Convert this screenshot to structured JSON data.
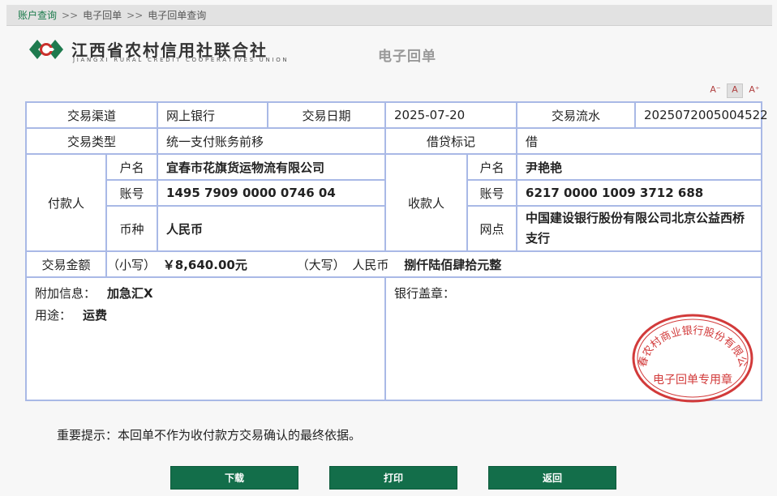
{
  "breadcrumb": {
    "items": [
      "账户查询",
      "电子回单",
      "电子回单查询"
    ],
    "separator": ">>"
  },
  "logo": {
    "cn": "江西省农村信用社联合社",
    "en": "JIANGXI RURAL CREDIT COOPERATIVES UNION"
  },
  "page_title": "电子回单",
  "font_size_controls": [
    "A⁻",
    "A",
    "A⁺"
  ],
  "receipt": {
    "row1": {
      "channel_label": "交易渠道",
      "channel_value": "网上银行",
      "date_label": "交易日期",
      "date_value": "2025-07-20",
      "serial_label": "交易流水",
      "serial_value": "2025072005004522"
    },
    "row2": {
      "type_label": "交易类型",
      "type_value": "统一支付账务前移",
      "dc_label": "借贷标记",
      "dc_value": "借"
    },
    "payer": {
      "label": "付款人",
      "name_label": "户名",
      "name": "宜春市花旗货运物流有限公司",
      "account_label": "账号",
      "account": "1495 7909 0000 0746 04",
      "currency_label": "币种",
      "currency": "人民币"
    },
    "payee": {
      "label": "收款人",
      "name_label": "户名",
      "name": "尹艳艳",
      "account_label": "账号",
      "account": "6217 0000 1009 3712 688",
      "branch_label": "网点",
      "branch": "中国建设银行股份有限公司北京公益西桥支行"
    },
    "amount": {
      "label": "交易金额",
      "small_label": "（小写）",
      "small_value": "￥8,640.00元",
      "big_label": "（大写）",
      "big_currency": "人民币",
      "big_value": "捌仟陆佰肆拾元整"
    },
    "extra": {
      "info_label": "附加信息：",
      "info_value": "加急汇X",
      "use_label": "用途：",
      "use_value": "运费",
      "seal_label": "银行盖章："
    },
    "seal": {
      "top_text": "宜春农村商业银行股份有限公司",
      "bottom_text": "电子回单专用章",
      "color": "#d23a3a"
    }
  },
  "notice": "重要提示：本回单不作为收付款方交易确认的最终依据。",
  "buttons": {
    "download": "下载",
    "print": "打印",
    "back": "返回"
  },
  "colors": {
    "brand_green": "#136e4a",
    "table_border": "#a9b9e6"
  }
}
